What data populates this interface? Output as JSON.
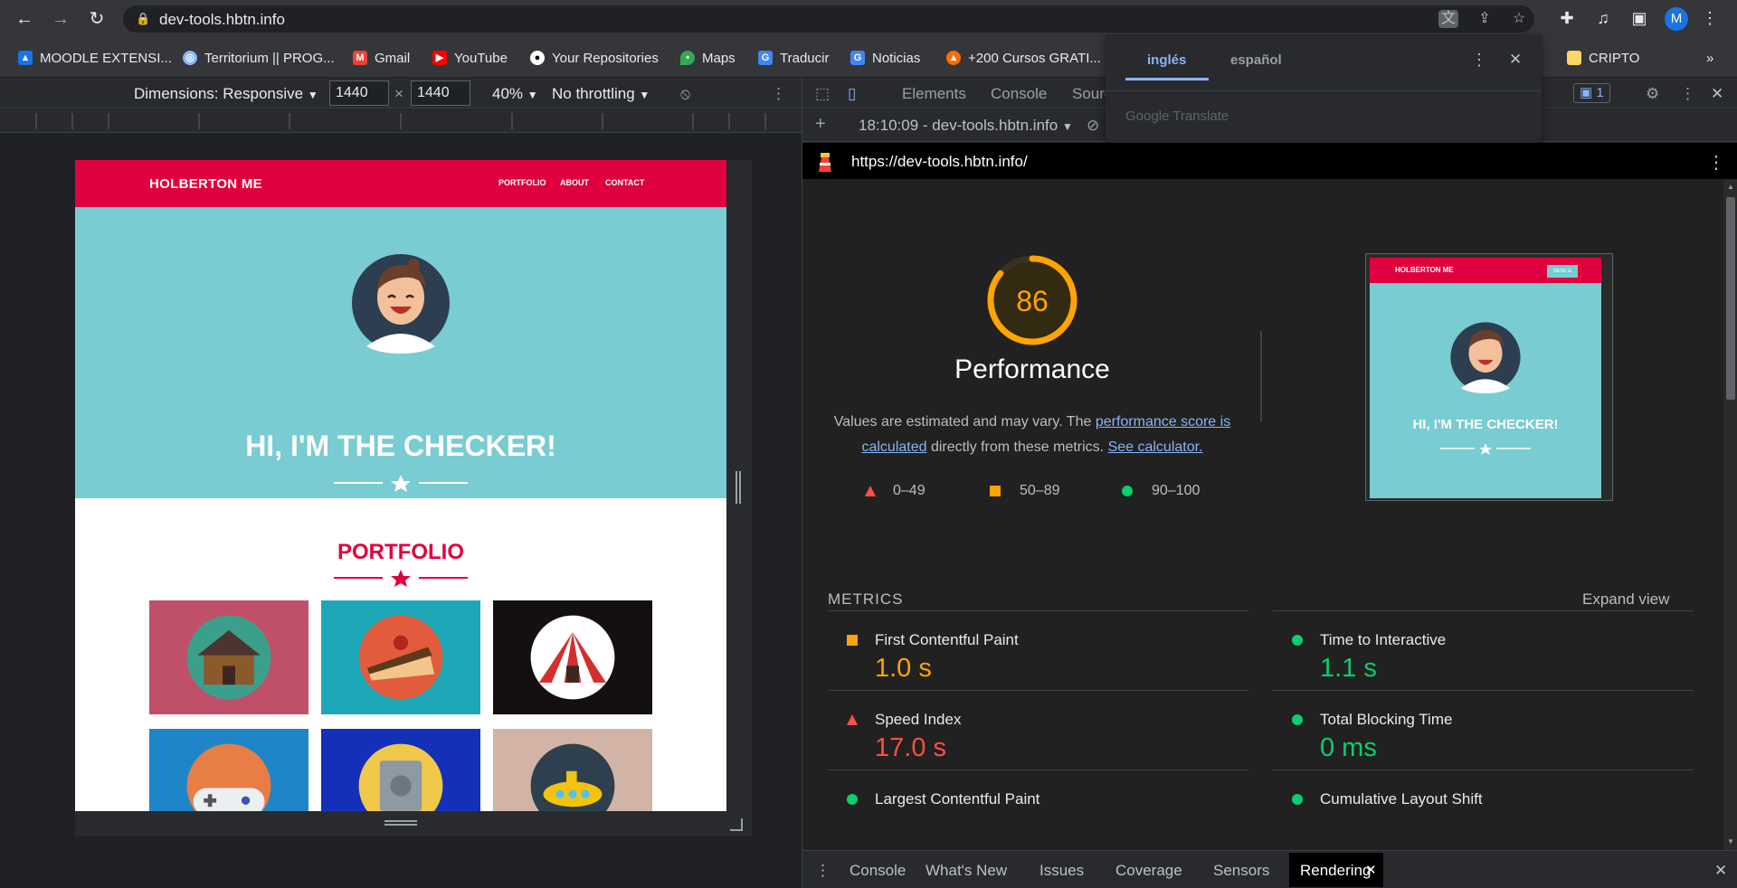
{
  "browser": {
    "url": "dev-tools.hbtn.info",
    "avatar_letter": "M",
    "bookmarks": [
      {
        "label": "MOODLE EXTENSI...",
        "color": "#1a73e8"
      },
      {
        "label": "Territorium || PROG...",
        "color": "#8ab4f8"
      },
      {
        "label": "Gmail",
        "color": "#ea4335"
      },
      {
        "label": "YouTube",
        "color": "#ff0000"
      },
      {
        "label": "Your Repositories",
        "color": "#ffffff"
      },
      {
        "label": "Maps",
        "color": "#34a853"
      },
      {
        "label": "Traducir",
        "color": "#4285f4"
      },
      {
        "label": "Noticias",
        "color": "#4285f4"
      },
      {
        "label": "+200 Cursos GRATI...",
        "color": "#ff6d00"
      },
      {
        "label": "CRIPTO",
        "color": "#fdd663"
      }
    ],
    "bookmarks_more": "»"
  },
  "translate": {
    "tab_source": "inglés",
    "tab_target": "español",
    "brand": "Google Translate",
    "close": "✕",
    "more": "⋮"
  },
  "device_toolbar": {
    "dimensions_label": "Dimensions: Responsive",
    "width": "1440",
    "height": "1440",
    "times": "×",
    "zoom": "40%",
    "throttling": "No throttling",
    "caret": "▼",
    "more": "⋮"
  },
  "site": {
    "brand": "HOLBERTON ME",
    "nav": [
      "PORTFOLIO",
      "ABOUT",
      "CONTACT"
    ],
    "hero_title": "HI, I'M THE CHECKER!",
    "portfolio_title": "PORTFOLIO",
    "tile_colors": [
      "#c0506a",
      "#1da7b7",
      "#141010",
      "#1e86c8",
      "#1530b8",
      "#d2b4a6"
    ],
    "tile_icons": [
      "cabin-icon",
      "cake-icon",
      "circus-tent-icon",
      "gamepad-icon",
      "safe-icon",
      "submarine-icon"
    ]
  },
  "devtools": {
    "tabs": [
      "Elements",
      "Console",
      "Sourc"
    ],
    "issues_count": "1",
    "report_time": "18:10:09 - dev-tools.hbtn.info",
    "report_url": "https://dev-tools.hbtn.info/",
    "add": "+",
    "close": "✕"
  },
  "lighthouse": {
    "score": 86,
    "category": "Performance",
    "desc_prefix": "Values are estimated and may vary. The ",
    "desc_link1": "performance score is calculated",
    "desc_middle": " directly from these metrics. ",
    "desc_link2": "See calculator.",
    "legend": [
      {
        "range": "0–49",
        "shape": "triangle",
        "color": "#ff4e42"
      },
      {
        "range": "50–89",
        "shape": "square",
        "color": "#ffa400"
      },
      {
        "range": "90–100",
        "shape": "circle",
        "color": "#0cce6b"
      }
    ],
    "thumb_brand": "HOLBERTON ME",
    "thumb_btn": "MENU ☰",
    "thumb_title": "HI, I'M THE CHECKER!",
    "metrics_heading": "METRICS",
    "expand_view": "Expand view",
    "metrics": [
      {
        "label": "First Contentful Paint",
        "value": "1.0 s",
        "status": "orange"
      },
      {
        "label": "Time to Interactive",
        "value": "1.1 s",
        "status": "green"
      },
      {
        "label": "Speed Index",
        "value": "17.0 s",
        "status": "red"
      },
      {
        "label": "Total Blocking Time",
        "value": "0 ms",
        "status": "green"
      },
      {
        "label": "Largest Contentful Paint",
        "value": "",
        "status": "green"
      },
      {
        "label": "Cumulative Layout Shift",
        "value": "",
        "status": "green"
      }
    ]
  },
  "drawer": {
    "tabs": [
      "Console",
      "What's New",
      "Issues",
      "Coverage",
      "Sensors",
      "Rendering"
    ],
    "active": "Rendering",
    "close": "✕"
  }
}
